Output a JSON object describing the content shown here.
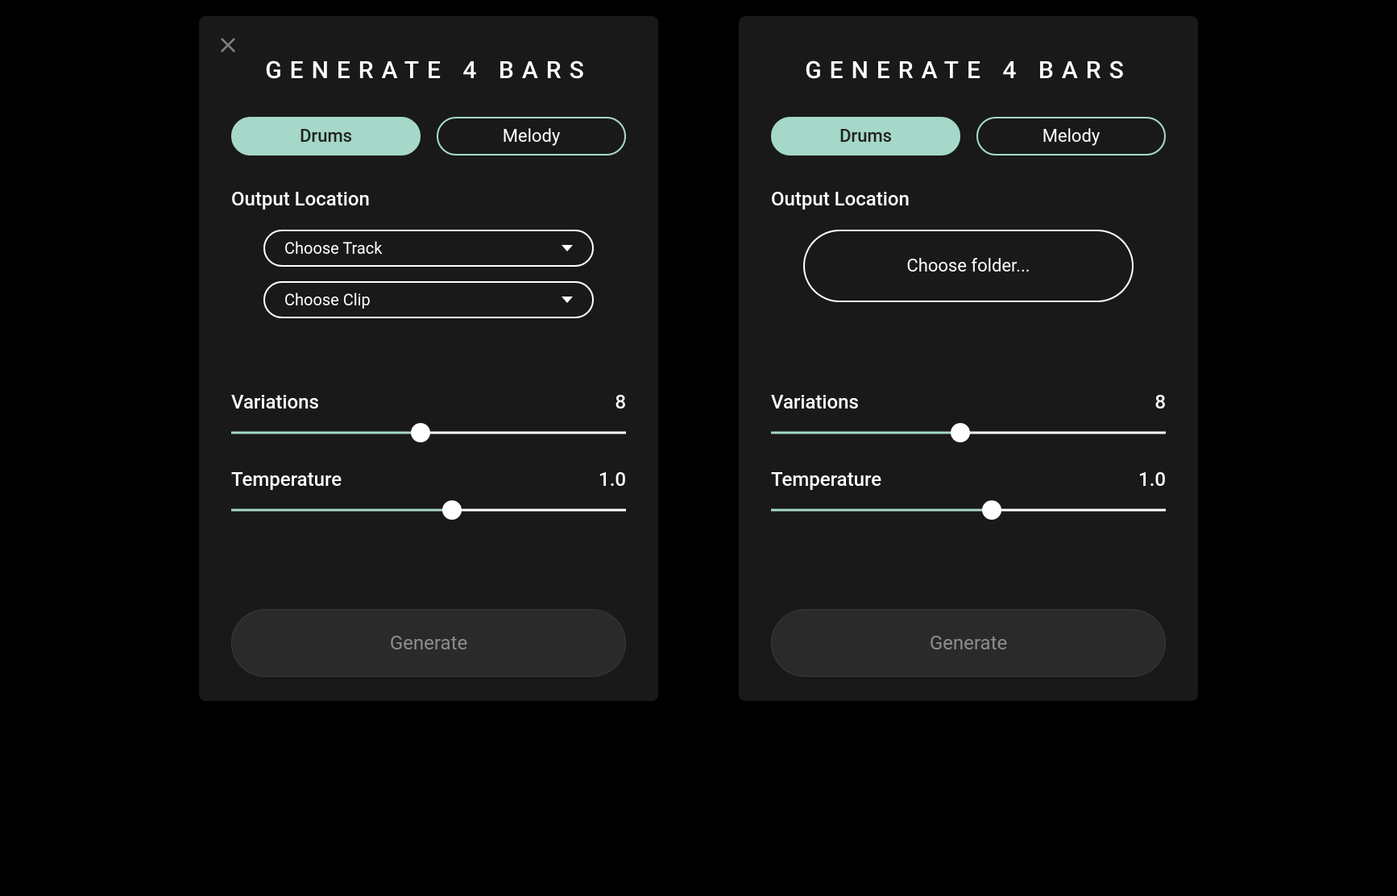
{
  "left": {
    "title": "GENERATE 4 BARS",
    "tabs": {
      "drums": "Drums",
      "melody": "Melody"
    },
    "output_label": "Output Location",
    "track_dropdown": "Choose Track",
    "clip_dropdown": "Choose Clip",
    "variations": {
      "label": "Variations",
      "value": "8",
      "percent": 48
    },
    "temperature": {
      "label": "Temperature",
      "value": "1.0",
      "percent": 56
    },
    "generate": "Generate"
  },
  "right": {
    "title": "GENERATE 4 BARS",
    "tabs": {
      "drums": "Drums",
      "melody": "Melody"
    },
    "output_label": "Output Location",
    "choose_folder": "Choose folder...",
    "variations": {
      "label": "Variations",
      "value": "8",
      "percent": 48
    },
    "temperature": {
      "label": "Temperature",
      "value": "1.0",
      "percent": 56
    },
    "generate": "Generate"
  },
  "colors": {
    "accent": "#a5d8c9"
  }
}
